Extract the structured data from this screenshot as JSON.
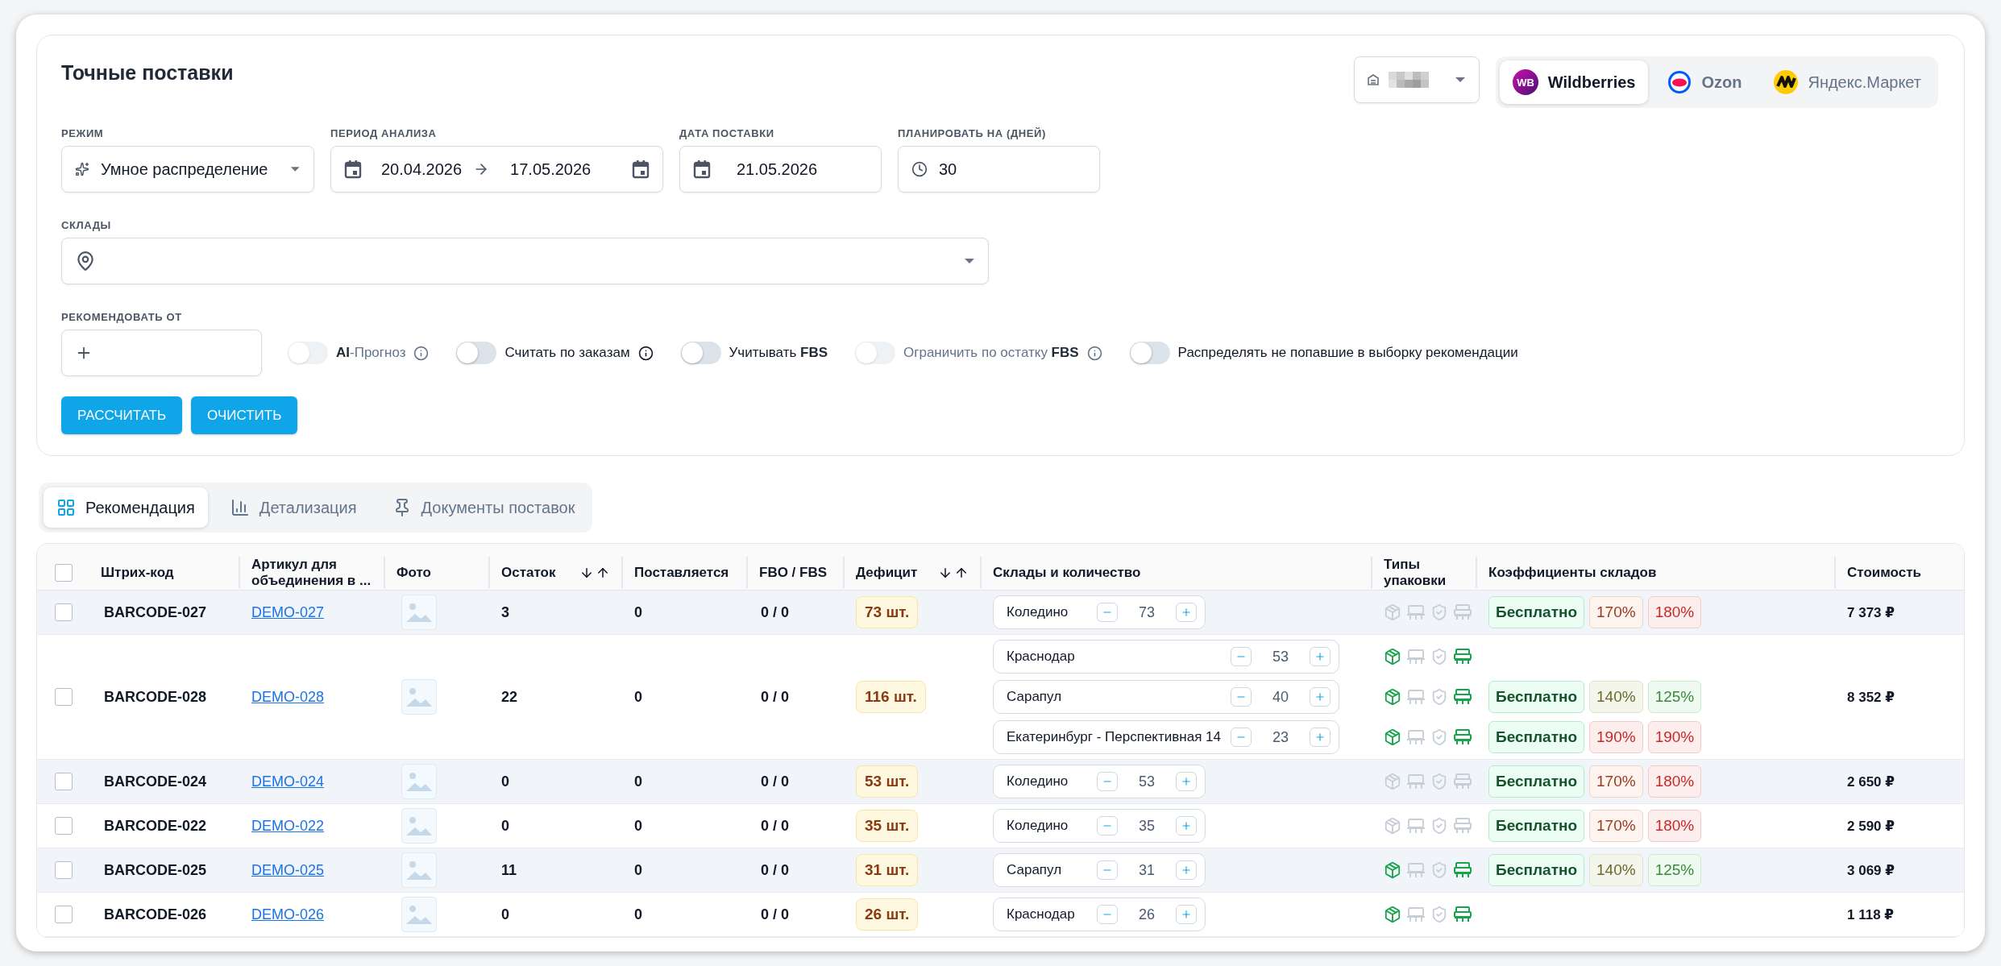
{
  "title": "Точные поставки",
  "marketplaces": [
    {
      "name": "Wildberries",
      "logo_text": "WB",
      "selected": true
    },
    {
      "name": "Ozon",
      "selected": false
    },
    {
      "name": "Яндекс.Маркет",
      "selected": false
    }
  ],
  "form": {
    "mode": {
      "label": "РЕЖИМ",
      "value": "Умное распределение"
    },
    "period": {
      "label": "ПЕРИОД АНАЛИЗА",
      "from": "20.04.2026",
      "to": "17.05.2026"
    },
    "delivery_date": {
      "label": "ДАТА ПОСТАВКИ",
      "value": "21.05.2026"
    },
    "plan_days": {
      "label": "ПЛАНИРОВАТЬ НА (ДНЕЙ)",
      "value": "30"
    },
    "warehouses": {
      "label": "СКЛАДЫ"
    },
    "recommend_from": {
      "label": "РЕКОМЕНДОВАТЬ ОТ"
    },
    "toggles": [
      {
        "label": "**AI**-Прогноз",
        "on": false,
        "info": true,
        "disabled": true
      },
      {
        "label": "Считать по заказам",
        "on": false,
        "info": true,
        "disabled": false
      },
      {
        "label": "Учитывать **FBS**",
        "on": false,
        "info": false,
        "disabled": false
      },
      {
        "label": "Ограничить по остатку **FBS**",
        "on": false,
        "info": true,
        "disabled": true
      },
      {
        "label": "Распределять не попавшие в выборку рекомендации",
        "on": false,
        "info": false,
        "disabled": false
      }
    ],
    "buttons": [
      "РАССЧИТАТЬ",
      "ОЧИСТИТЬ"
    ]
  },
  "view_tabs": [
    {
      "label": "Рекомендация",
      "selected": true
    },
    {
      "label": "Детализация",
      "selected": false
    },
    {
      "label": "Документы поставок",
      "selected": false
    }
  ],
  "table": {
    "columns": [
      {
        "kind": "checkbox",
        "checked": false
      },
      {
        "kind": "text",
        "label": "Штрих-код",
        "sortable": false
      },
      {
        "kind": "text",
        "label": "Артикул для объединения в ...",
        "sortable": false
      },
      {
        "kind": "text",
        "label": "Фото",
        "sortable": false
      },
      {
        "kind": "text",
        "label": "Остаток",
        "sortable": true
      },
      {
        "kind": "text",
        "label": "Поставляется",
        "sortable": false
      },
      {
        "kind": "text",
        "label": "FBO / FBS",
        "sortable": false
      },
      {
        "kind": "text",
        "label": "Дефицит",
        "sortable": true
      },
      {
        "kind": "text",
        "label": "Склады и количество",
        "sortable": false
      },
      {
        "kind": "text",
        "label": "Типы упаковки",
        "sortable": false
      },
      {
        "kind": "text",
        "label": "Коэффициенты складов",
        "sortable": false
      },
      {
        "kind": "text",
        "label": "Стоимость",
        "sortable": false
      }
    ],
    "rows": [
      {
        "checked": false,
        "barcode": "BARCODE-027",
        "article": "DEMO-027",
        "stock": "3",
        "supplied": "0",
        "fbo_fbs": "0 / 0",
        "deficit": "73 шт.",
        "cost": "7 373 ₽",
        "warehouses": [
          {
            "name": "Коледино",
            "qty": "73",
            "packaging": [
              {
                "kind": "box",
                "active": false
              },
              {
                "kind": "pallet",
                "active": false
              },
              {
                "kind": "safe",
                "active": false
              },
              {
                "kind": "supersafe",
                "active": false
              }
            ],
            "coefficients": [
              {
                "text": "Бесплатно",
                "kind": "free"
              },
              {
                "text": "170%",
                "kind": "orange"
              },
              {
                "text": "180%",
                "kind": "red"
              }
            ]
          }
        ]
      },
      {
        "checked": false,
        "barcode": "BARCODE-028",
        "article": "DEMO-028",
        "stock": "22",
        "supplied": "0",
        "fbo_fbs": "0 / 0",
        "deficit": "116 шт.",
        "cost": "8 352 ₽",
        "warehouses": [
          {
            "name": "Краснодар",
            "qty": "53",
            "packaging": [
              {
                "kind": "box",
                "active": true
              },
              {
                "kind": "pallet",
                "active": false
              },
              {
                "kind": "safe",
                "active": false
              },
              {
                "kind": "supersafe",
                "active": true
              }
            ]
          },
          {
            "name": "Сарапул",
            "qty": "40",
            "packaging": [
              {
                "kind": "box",
                "active": true
              },
              {
                "kind": "pallet",
                "active": false
              },
              {
                "kind": "safe",
                "active": false
              },
              {
                "kind": "supersafe",
                "active": true
              }
            ],
            "coefficients": [
              {
                "text": "Бесплатно",
                "kind": "free"
              },
              {
                "text": "140%",
                "kind": "olive"
              },
              {
                "text": "125%",
                "kind": "green"
              }
            ]
          },
          {
            "name": "Екатеринбург - Перспективная 14",
            "qty": "23",
            "packaging": [
              {
                "kind": "box",
                "active": true
              },
              {
                "kind": "pallet",
                "active": false
              },
              {
                "kind": "safe",
                "active": false
              },
              {
                "kind": "supersafe",
                "active": true
              }
            ],
            "coefficients": [
              {
                "text": "Бесплатно",
                "kind": "free"
              },
              {
                "text": "190%",
                "kind": "red"
              },
              {
                "text": "190%",
                "kind": "red"
              }
            ]
          }
        ]
      },
      {
        "checked": false,
        "barcode": "BARCODE-024",
        "article": "DEMO-024",
        "stock": "0",
        "supplied": "0",
        "fbo_fbs": "0 / 0",
        "deficit": "53 шт.",
        "cost": "2 650 ₽",
        "warehouses": [
          {
            "name": "Коледино",
            "qty": "53",
            "packaging": [
              {
                "kind": "box",
                "active": false
              },
              {
                "kind": "pallet",
                "active": false
              },
              {
                "kind": "safe",
                "active": false
              },
              {
                "kind": "supersafe",
                "active": false
              }
            ],
            "coefficients": [
              {
                "text": "Бесплатно",
                "kind": "free"
              },
              {
                "text": "170%",
                "kind": "orange"
              },
              {
                "text": "180%",
                "kind": "red"
              }
            ]
          }
        ]
      },
      {
        "checked": false,
        "barcode": "BARCODE-022",
        "article": "DEMO-022",
        "stock": "0",
        "supplied": "0",
        "fbo_fbs": "0 / 0",
        "deficit": "35 шт.",
        "cost": "2 590 ₽",
        "warehouses": [
          {
            "name": "Коледино",
            "qty": "35",
            "packaging": [
              {
                "kind": "box",
                "active": false
              },
              {
                "kind": "pallet",
                "active": false
              },
              {
                "kind": "safe",
                "active": false
              },
              {
                "kind": "supersafe",
                "active": false
              }
            ],
            "coefficients": [
              {
                "text": "Бесплатно",
                "kind": "free"
              },
              {
                "text": "170%",
                "kind": "orange"
              },
              {
                "text": "180%",
                "kind": "red"
              }
            ]
          }
        ]
      },
      {
        "checked": false,
        "barcode": "BARCODE-025",
        "article": "DEMO-025",
        "stock": "11",
        "supplied": "0",
        "fbo_fbs": "0 / 0",
        "deficit": "31 шт.",
        "cost": "3 069 ₽",
        "warehouses": [
          {
            "name": "Сарапул",
            "qty": "31",
            "packaging": [
              {
                "kind": "box",
                "active": true
              },
              {
                "kind": "pallet",
                "active": false
              },
              {
                "kind": "safe",
                "active": false
              },
              {
                "kind": "supersafe",
                "active": true
              }
            ],
            "coefficients": [
              {
                "text": "Бесплатно",
                "kind": "free"
              },
              {
                "text": "140%",
                "kind": "olive"
              },
              {
                "text": "125%",
                "kind": "green"
              }
            ]
          }
        ]
      },
      {
        "checked": false,
        "barcode": "BARCODE-026",
        "article": "DEMO-026",
        "stock": "0",
        "supplied": "0",
        "fbo_fbs": "0 / 0",
        "deficit": "26 шт.",
        "cost": "1 118 ₽",
        "warehouses": [
          {
            "name": "Краснодар",
            "qty": "26",
            "packaging": [
              {
                "kind": "box",
                "active": true
              },
              {
                "kind": "pallet",
                "active": false
              },
              {
                "kind": "safe",
                "active": false
              },
              {
                "kind": "supersafe",
                "active": true
              }
            ]
          }
        ]
      }
    ]
  }
}
